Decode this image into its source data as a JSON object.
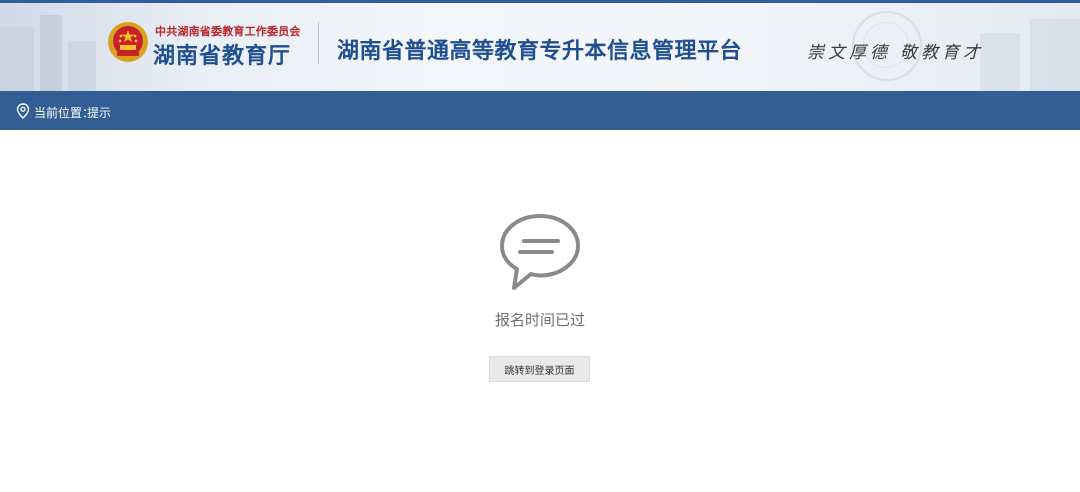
{
  "header": {
    "org_subtitle": "中共湖南省委教育工作委员会",
    "org_title": "湖南省教育厅",
    "platform_title": "湖南省普通高等教育专升本信息管理平台",
    "slogan_1": "崇文厚德",
    "slogan_2": "敬教育才",
    "colors": {
      "brand_blue": "#1f4f8e",
      "org_red": "#b8262a"
    }
  },
  "location_bar": {
    "label": "当前位置：",
    "value": "提示",
    "icon": "location-pin-icon",
    "background": "#335e94"
  },
  "notice": {
    "icon": "chat-bubble-icon",
    "message": "报名时间已过",
    "button_label": "跳转到登录页面"
  }
}
